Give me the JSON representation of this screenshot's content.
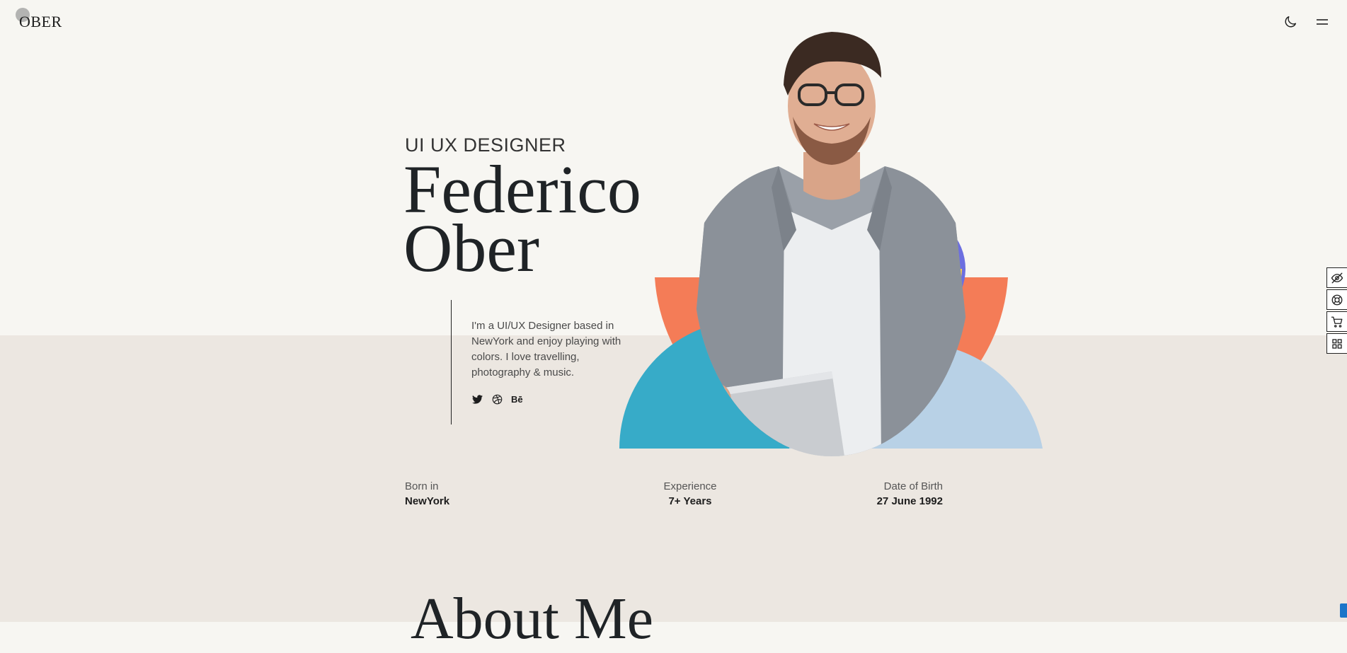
{
  "header": {
    "logo": "OBER",
    "theme_toggle_icon": "moon-icon",
    "menu_icon": "hamburger-menu-icon"
  },
  "hero": {
    "subtitle": "UI UX DESIGNER",
    "first_name": "Federico",
    "last_name": "Ober",
    "bio": "I'm a UI/UX Designer based in NewYork and enjoy playing with colors. I love travelling, photography & music.",
    "social": {
      "twitter_icon": "twitter-icon",
      "dribbble_icon": "dribbble-icon",
      "behance_label": "Bē"
    }
  },
  "stats": [
    {
      "label": "Born in",
      "value": "NewYork"
    },
    {
      "label": "Experience",
      "value": "7+ Years"
    },
    {
      "label": "Date of Birth",
      "value": "27 June 1992"
    }
  ],
  "about": {
    "heading": "About Me"
  },
  "side_tools": [
    "eye-off-icon",
    "support-icon",
    "cart-icon",
    "grid-icon"
  ],
  "colors": {
    "coral": "#f47c57",
    "teal": "#37abc8",
    "purple": "#6c6fe0",
    "yellow": "#fdd14a",
    "light_blue": "#b8d1e6",
    "top_bg": "#f7f6f2",
    "bottom_bg": "#ece7e1"
  }
}
